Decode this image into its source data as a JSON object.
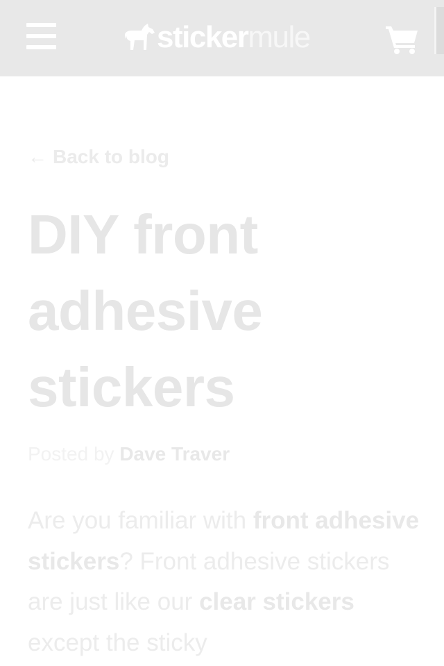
{
  "header": {
    "logo_primary": "sticker",
    "logo_secondary": "mule",
    "background": "#e8e8e8"
  },
  "icons": {
    "menu": "hamburger-menu-icon",
    "logo": "mule-silhouette-icon",
    "cart": "shopping-cart-icon"
  },
  "nav": {
    "back_arrow": "←",
    "back_label": "Back to blog"
  },
  "article": {
    "title": "DIY front adhesive stickers",
    "byline_prefix": "Posted by ",
    "author": "Dave Traver",
    "intro": {
      "t1": "Are you familiar with ",
      "link1": "front adhesive stickers",
      "t2": "? Front adhesive stickers are just like our ",
      "link2": "clear stickers",
      "t3": " except the sticky"
    }
  }
}
